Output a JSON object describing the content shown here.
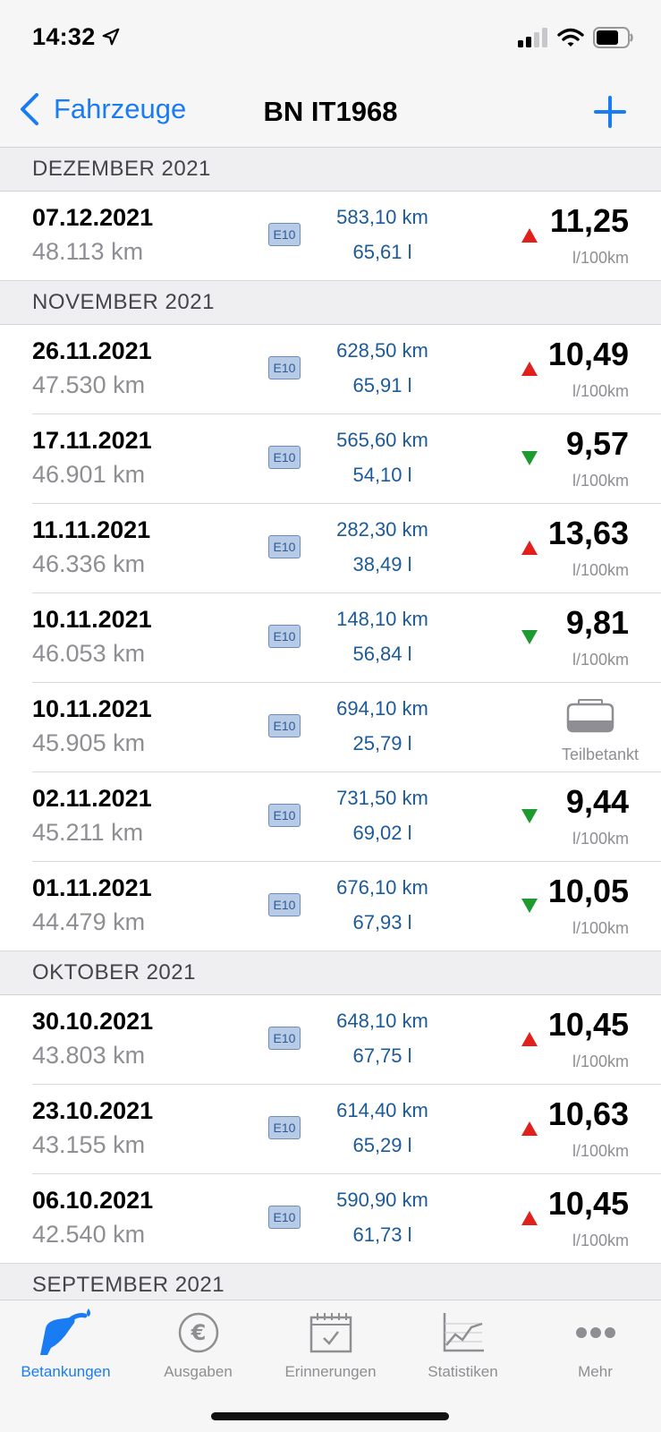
{
  "status_bar": {
    "time": "14:32"
  },
  "nav": {
    "back_label": "Fahrzeuge",
    "title": "BN IT1968"
  },
  "sections": [
    {
      "title": "DEZEMBER 2021",
      "rows": [
        {
          "date": "07.12.2021",
          "odometer": "48.113 km",
          "fuel": "E10",
          "distance": "583,10 km",
          "liters": "65,61 l",
          "trend": "up",
          "consumption": "11,25",
          "unit": "l/100km"
        }
      ]
    },
    {
      "title": "NOVEMBER 2021",
      "rows": [
        {
          "date": "26.11.2021",
          "odometer": "47.530 km",
          "fuel": "E10",
          "distance": "628,50 km",
          "liters": "65,91 l",
          "trend": "up",
          "consumption": "10,49",
          "unit": "l/100km"
        },
        {
          "date": "17.11.2021",
          "odometer": "46.901 km",
          "fuel": "E10",
          "distance": "565,60 km",
          "liters": "54,10 l",
          "trend": "down",
          "consumption": "9,57",
          "unit": "l/100km"
        },
        {
          "date": "11.11.2021",
          "odometer": "46.336 km",
          "fuel": "E10",
          "distance": "282,30 km",
          "liters": "38,49 l",
          "trend": "up",
          "consumption": "13,63",
          "unit": "l/100km"
        },
        {
          "date": "10.11.2021",
          "odometer": "46.053 km",
          "fuel": "E10",
          "distance": "148,10 km",
          "liters": "56,84 l",
          "trend": "down",
          "consumption": "9,81",
          "unit": "l/100km"
        },
        {
          "date": "10.11.2021",
          "odometer": "45.905 km",
          "fuel": "E10",
          "distance": "694,10 km",
          "liters": "25,79 l",
          "partial": true,
          "partial_label": "Teilbetankt",
          "icon": "partial-tank-icon"
        },
        {
          "date": "02.11.2021",
          "odometer": "45.211 km",
          "fuel": "E10",
          "distance": "731,50 km",
          "liters": "69,02 l",
          "trend": "down",
          "consumption": "9,44",
          "unit": "l/100km"
        },
        {
          "date": "01.11.2021",
          "odometer": "44.479 km",
          "fuel": "E10",
          "distance": "676,10 km",
          "liters": "67,93 l",
          "trend": "down",
          "consumption": "10,05",
          "unit": "l/100km"
        }
      ]
    },
    {
      "title": "OKTOBER 2021",
      "rows": [
        {
          "date": "30.10.2021",
          "odometer": "43.803 km",
          "fuel": "E10",
          "distance": "648,10 km",
          "liters": "67,75 l",
          "trend": "up",
          "consumption": "10,45",
          "unit": "l/100km"
        },
        {
          "date": "23.10.2021",
          "odometer": "43.155 km",
          "fuel": "E10",
          "distance": "614,40 km",
          "liters": "65,29 l",
          "trend": "up",
          "consumption": "10,63",
          "unit": "l/100km"
        },
        {
          "date": "06.10.2021",
          "odometer": "42.540 km",
          "fuel": "E10",
          "distance": "590,90 km",
          "liters": "61,73 l",
          "trend": "up",
          "consumption": "10,45",
          "unit": "l/100km"
        }
      ]
    },
    {
      "title": "SEPTEMBER 2021",
      "rows": []
    }
  ],
  "tab_bar": {
    "tabs": [
      {
        "label": "Betankungen",
        "icon": "fuel-pump-icon",
        "active": true
      },
      {
        "label": "Ausgaben",
        "icon": "euro-icon",
        "active": false
      },
      {
        "label": "Erinnerungen",
        "icon": "calendar-check-icon",
        "active": false
      },
      {
        "label": "Statistiken",
        "icon": "chart-icon",
        "active": false
      },
      {
        "label": "Mehr",
        "icon": "more-icon",
        "active": false
      }
    ]
  },
  "colors": {
    "accent": "#1a7cf2",
    "trend_up": "#e0201c",
    "trend_down": "#1f9a2e",
    "value_blue": "#1c5a99"
  }
}
